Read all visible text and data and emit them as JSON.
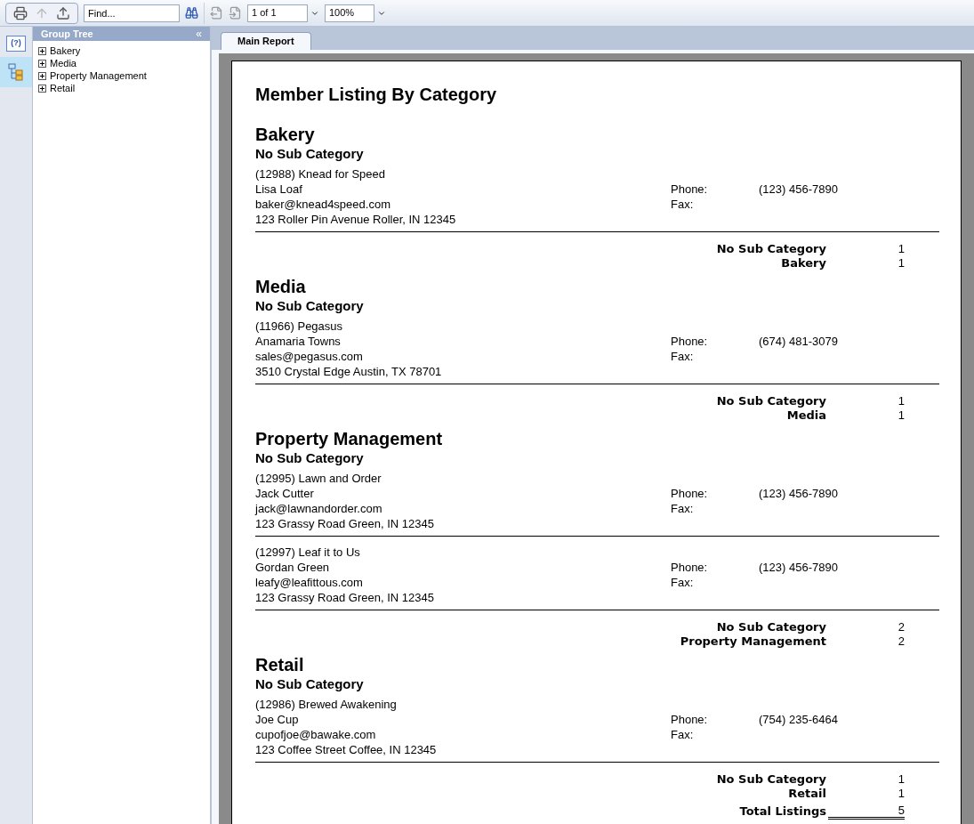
{
  "side_rail": {
    "help": "(?)"
  },
  "toolbar": {
    "find": {
      "placeholder": "Find..."
    },
    "page": "1 of 1",
    "zoom": "100%"
  },
  "group_tree": {
    "title": "Group Tree",
    "collapse": "«",
    "items": [
      {
        "label": "Bakery",
        "expanded": false
      },
      {
        "label": "Media",
        "expanded": false
      },
      {
        "label": "Property Management",
        "expanded": false
      },
      {
        "label": "Retail",
        "expanded": false
      }
    ]
  },
  "tabs": [
    {
      "label": "Main Report",
      "selected": true
    }
  ],
  "report": {
    "title": "Member Listing By Category",
    "categories": [
      {
        "name": "Bakery",
        "subcategories": [
          {
            "name": "No Sub Category",
            "members": [
              {
                "heading": "(12988) Knead for Speed",
                "contact": "Lisa Loaf",
                "email": "baker@knead4speed.com",
                "address": "123 Roller Pin Avenue Roller, IN 12345",
                "phone_label": "Phone:",
                "phone": "(123) 456-7890",
                "fax_label": "Fax:"
              }
            ],
            "subtotal_label": "No Sub Category",
            "subtotal": "1"
          }
        ],
        "total_label": "Bakery",
        "total": "1"
      },
      {
        "name": "Media",
        "subcategories": [
          {
            "name": "No Sub Category",
            "members": [
              {
                "heading": "(11966) Pegasus",
                "contact": "Anamaria Towns",
                "email": "sales@pegasus.com",
                "address": "3510 Crystal Edge Austin, TX 78701",
                "phone_label": "Phone:",
                "phone": "(674) 481-3079",
                "fax_label": "Fax:"
              }
            ],
            "subtotal_label": "No Sub Category",
            "subtotal": "1"
          }
        ],
        "total_label": "Media",
        "total": "1"
      },
      {
        "name": "Property Management",
        "subcategories": [
          {
            "name": "No Sub Category",
            "members": [
              {
                "heading": "(12995) Lawn and Order",
                "contact": "Jack Cutter",
                "email": "jack@lawnandorder.com",
                "address": "123 Grassy Road Green, IN 12345",
                "phone_label": "Phone:",
                "phone": "(123) 456-7890",
                "fax_label": "Fax:"
              },
              {
                "heading": "(12997) Leaf it to Us",
                "contact": "Gordan Green",
                "email": "leafy@leafittous.com",
                "address": "123 Grassy Road Green, IN 12345",
                "phone_label": "Phone:",
                "phone": "(123) 456-7890",
                "fax_label": "Fax:"
              }
            ],
            "subtotal_label": "No Sub Category",
            "subtotal": "2"
          }
        ],
        "total_label": "Property Management",
        "total": "2"
      },
      {
        "name": "Retail",
        "subcategories": [
          {
            "name": "No Sub Category",
            "members": [
              {
                "heading": "(12986) Brewed Awakening",
                "contact": "Joe Cup",
                "email": "cupofjoe@bawake.com",
                "address": "123 Coffee Street Coffee, IN 12345",
                "phone_label": "Phone:",
                "phone": "(754) 235-6464",
                "fax_label": "Fax:"
              }
            ],
            "subtotal_label": "No Sub Category",
            "subtotal": "1"
          }
        ],
        "total_label": "Retail",
        "total": "1"
      }
    ],
    "grand_total_label": "Total Listings",
    "grand_total": "5"
  }
}
